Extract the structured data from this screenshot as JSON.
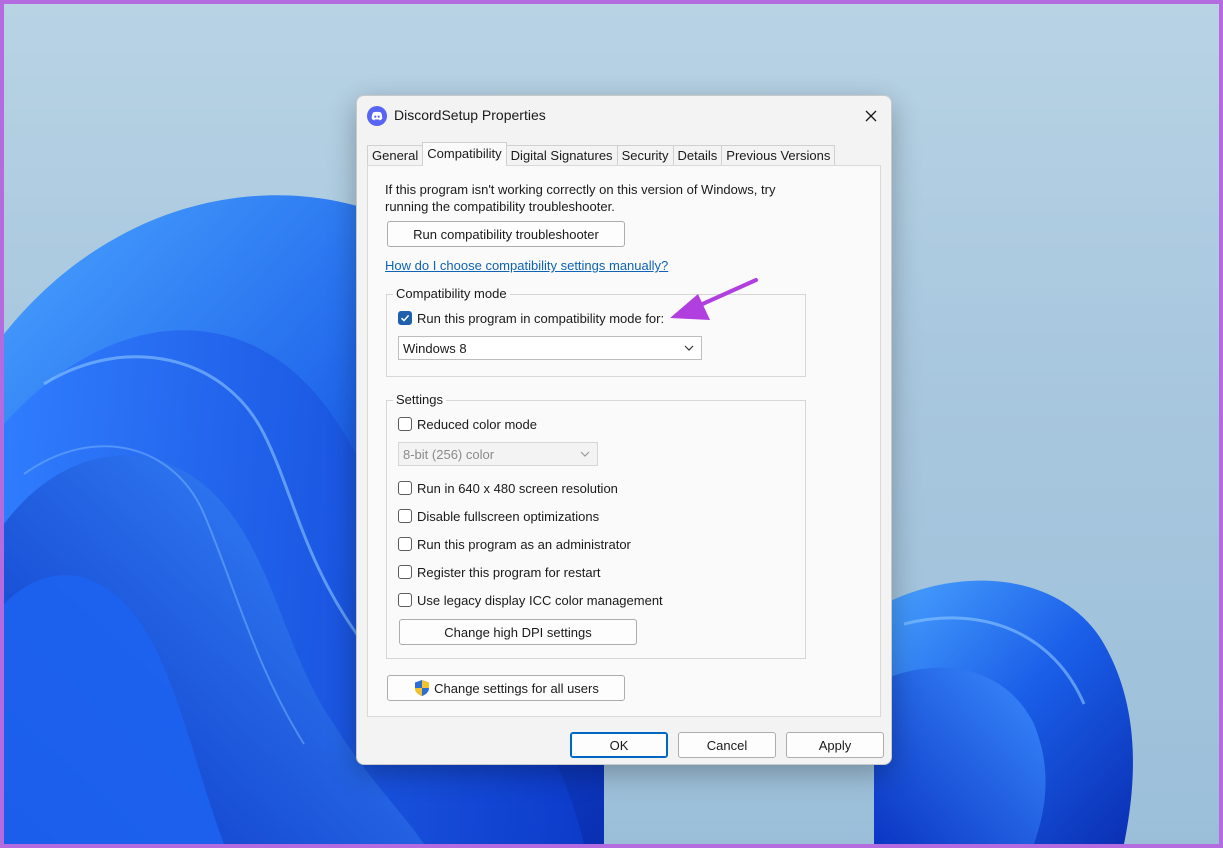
{
  "dialog": {
    "title": "DiscordSetup Properties",
    "tabs": [
      {
        "label": "General",
        "active": false
      },
      {
        "label": "Compatibility",
        "active": true
      },
      {
        "label": "Digital Signatures",
        "active": false
      },
      {
        "label": "Security",
        "active": false
      },
      {
        "label": "Details",
        "active": false
      },
      {
        "label": "Previous Versions",
        "active": false
      }
    ]
  },
  "compat": {
    "intro": "If this program isn't working correctly on this version of Windows, try running the compatibility troubleshooter.",
    "troubleshooter_button": "Run compatibility troubleshooter",
    "help_link": "How do I choose compatibility settings manually?",
    "mode_group": {
      "label": "Compatibility mode",
      "checkbox_label": "Run this program in compatibility mode for:",
      "checked": true,
      "selected_os": "Windows 8"
    },
    "settings_group": {
      "label": "Settings",
      "reduced_color": "Reduced color mode",
      "color_depth": "8-bit (256) color",
      "resolution": "Run in 640 x 480 screen resolution",
      "fullscreen": "Disable fullscreen optimizations",
      "admin": "Run this program as an administrator",
      "restart": "Register this program for restart",
      "icc": "Use legacy display ICC color management",
      "dpi_button": "Change high DPI settings"
    },
    "all_users_button": "Change settings for all users"
  },
  "footer": {
    "ok": "OK",
    "cancel": "Cancel",
    "apply": "Apply"
  },
  "colors": {
    "accent": "#1f5fae",
    "link": "#0e63b5",
    "annotation_arrow": "#b13fe0",
    "discord": "#5865f2"
  }
}
